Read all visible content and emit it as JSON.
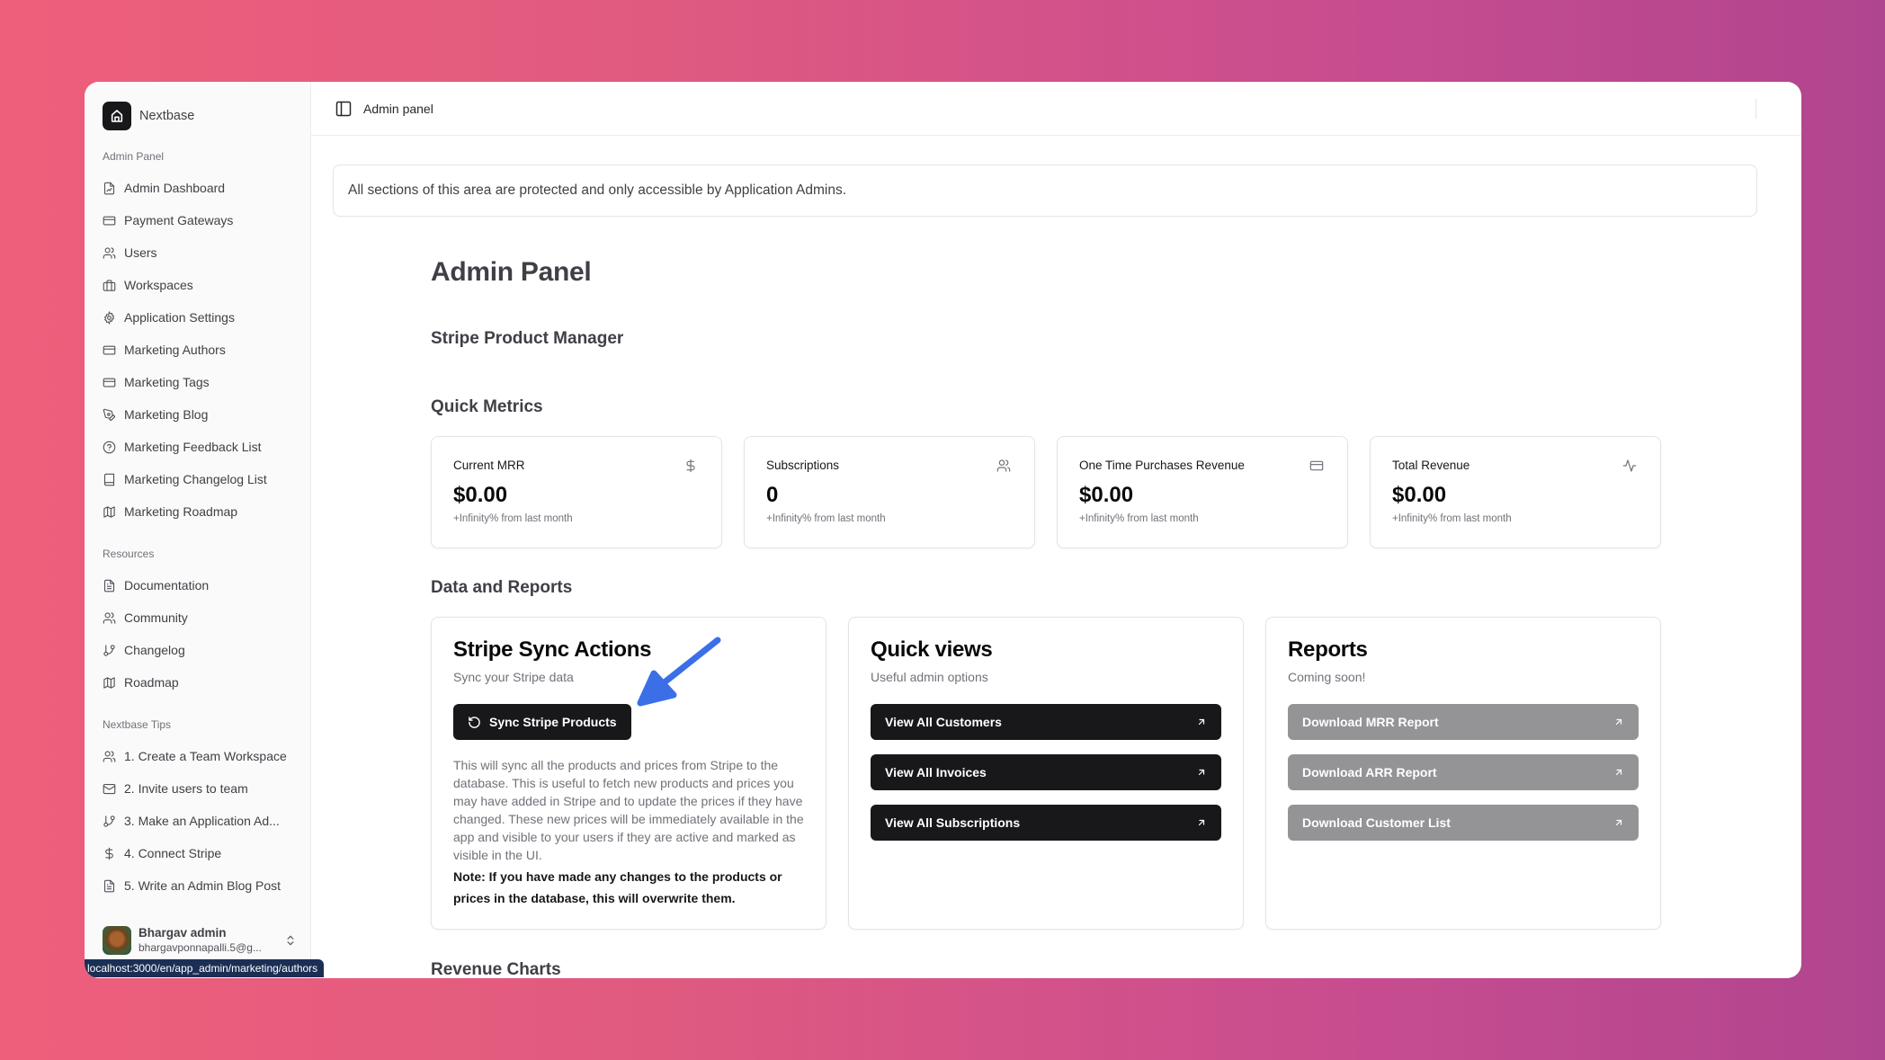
{
  "sidebar": {
    "brand": "Nextbase",
    "groups": [
      {
        "label": "Admin Panel",
        "items": [
          {
            "label": "Admin Dashboard",
            "icon": "file-chart-icon"
          },
          {
            "label": "Payment Gateways",
            "icon": "credit-card-icon"
          },
          {
            "label": "Users",
            "icon": "users-icon"
          },
          {
            "label": "Workspaces",
            "icon": "briefcase-icon"
          },
          {
            "label": "Application Settings",
            "icon": "gear-icon"
          },
          {
            "label": "Marketing Authors",
            "icon": "credit-card-icon"
          },
          {
            "label": "Marketing Tags",
            "icon": "credit-card-icon"
          },
          {
            "label": "Marketing Blog",
            "icon": "pen-tool-icon"
          },
          {
            "label": "Marketing Feedback List",
            "icon": "help-circle-icon"
          },
          {
            "label": "Marketing Changelog List",
            "icon": "book-icon"
          },
          {
            "label": "Marketing Roadmap",
            "icon": "map-icon"
          }
        ]
      },
      {
        "label": "Resources",
        "items": [
          {
            "label": "Documentation",
            "icon": "file-text-icon"
          },
          {
            "label": "Community",
            "icon": "users-icon"
          },
          {
            "label": "Changelog",
            "icon": "git-branch-icon"
          },
          {
            "label": "Roadmap",
            "icon": "map-icon"
          }
        ]
      },
      {
        "label": "Nextbase Tips",
        "items": [
          {
            "label": "1. Create a Team Workspace",
            "icon": "users-icon"
          },
          {
            "label": "2. Invite users to team",
            "icon": "mail-icon"
          },
          {
            "label": "3. Make an Application Ad...",
            "icon": "git-branch-icon"
          },
          {
            "label": "4. Connect Stripe",
            "icon": "dollar-icon"
          },
          {
            "label": "5. Write an Admin Blog Post",
            "icon": "file-text-icon"
          }
        ]
      }
    ],
    "user": {
      "name": "Bhargav admin",
      "email": "bhargavponnapalli.5@g..."
    }
  },
  "status_bar_url": "localhost:3000/en/app_admin/marketing/authors",
  "topbar": {
    "title": "Admin panel"
  },
  "notice": "All sections of this area are protected and only accessible by Application Admins.",
  "page": {
    "title": "Admin Panel",
    "stripe_manager_heading": "Stripe Product Manager",
    "quick_metrics_heading": "Quick Metrics",
    "data_reports_heading": "Data and Reports",
    "revenue_charts_heading": "Revenue Charts"
  },
  "metrics": [
    {
      "label": "Current MRR",
      "value": "$0.00",
      "delta": "+Infinity% from last month",
      "icon": "dollar-icon"
    },
    {
      "label": "Subscriptions",
      "value": "0",
      "delta": "+Infinity% from last month",
      "icon": "users-icon"
    },
    {
      "label": "One Time Purchases Revenue",
      "value": "$0.00",
      "delta": "+Infinity% from last month",
      "icon": "credit-card-icon"
    },
    {
      "label": "Total Revenue",
      "value": "$0.00",
      "delta": "+Infinity% from last month",
      "icon": "activity-icon"
    }
  ],
  "stripe_sync": {
    "title": "Stripe Sync Actions",
    "subtitle": "Sync your Stripe data",
    "button": "Sync Stripe Products",
    "description": "This will sync all the products and prices from Stripe to the database. This is useful to fetch new products and prices you may have added in Stripe and to update the prices if they have changed. These new prices will be immediately available in the app and visible to your users if they are active and marked as visible in the UI.",
    "note": "Note: If you have made any changes to the products or prices in the database, this will overwrite them."
  },
  "quick_views": {
    "title": "Quick views",
    "subtitle": "Useful admin options",
    "links": [
      "View All Customers",
      "View All Invoices",
      "View All Subscriptions"
    ]
  },
  "reports": {
    "title": "Reports",
    "subtitle": "Coming soon!",
    "links": [
      "Download MRR Report",
      "Download ARR Report",
      "Download Customer List"
    ]
  },
  "colors": {
    "annotation_arrow": "#3b6fe8",
    "primary_button": "#18181b",
    "disabled_button": "#949496"
  }
}
